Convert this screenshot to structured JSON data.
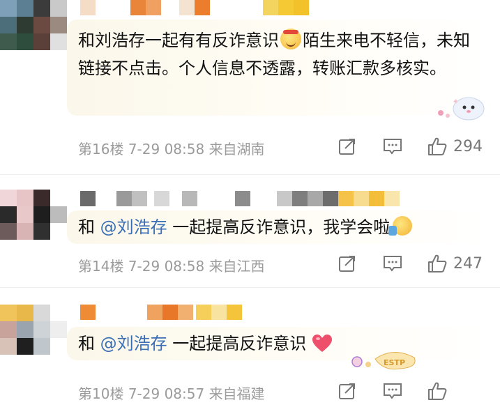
{
  "comments": [
    {
      "text_a": "和刘浩存一起有有反诈意识",
      "text_b": "陌生来电不轻信，未知链接不点击。个人信息不透露，转账汇款多核实。",
      "floor": "第16楼",
      "date": "7-29",
      "time": "08:58",
      "location": "来自湖南",
      "likes": "294"
    },
    {
      "prefix": "和 ",
      "mention": "@刘浩存",
      "text": " 一起提高反诈意识，我学会啦",
      "floor": "第14楼",
      "date": "7-29",
      "time": "08:58",
      "location": "来自江西",
      "likes": "247"
    },
    {
      "prefix": "和 ",
      "mention": "@刘浩存",
      "text": " 一起提高反诈意识",
      "floor": "第10楼",
      "date": "7-29",
      "time": "08:57",
      "location": "来自福建",
      "likes": "",
      "sticker_text": "ESTP"
    }
  ],
  "colors": {
    "mention": "#3a6fb5",
    "meta": "#9b9b9b",
    "bubble": "#fbf7ea"
  },
  "icons": [
    "share-icon",
    "comment-icon",
    "like-icon"
  ]
}
